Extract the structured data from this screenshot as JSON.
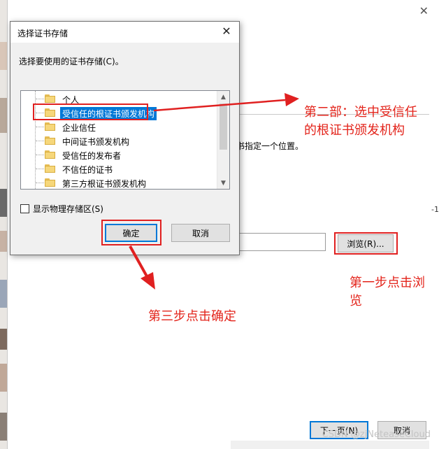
{
  "dialog": {
    "title": "选择证书存储",
    "prompt": "选择要使用的证书存储(C)。",
    "tree_items": [
      {
        "label": "个人",
        "selected": false
      },
      {
        "label": "受信任的根证书颁发机构",
        "selected": true
      },
      {
        "label": "企业信任",
        "selected": false
      },
      {
        "label": "中间证书颁发机构",
        "selected": false
      },
      {
        "label": "受信任的发布者",
        "selected": false
      },
      {
        "label": "不信任的证书",
        "selected": false
      },
      {
        "label": "第三方根证书颁发机构",
        "selected": false
      }
    ],
    "show_physical_label": "显示物理存储区(S)",
    "show_physical_checked": false,
    "ok_label": "确定",
    "cancel_label": "取消"
  },
  "background_window": {
    "partial_text": "书指定一个位置。",
    "browse_label": "浏览(R)...",
    "next_label": "下一页(N)",
    "cancel_label": "取消",
    "edge_text": "-1"
  },
  "annotations": {
    "step2": "第二部：选中受信任的根证书颁发机构",
    "step1": "第一步点击浏览",
    "step3": "第三步点击确定",
    "color": "#e3231a"
  },
  "watermark": "CSDN @zjNeteaseCloud"
}
